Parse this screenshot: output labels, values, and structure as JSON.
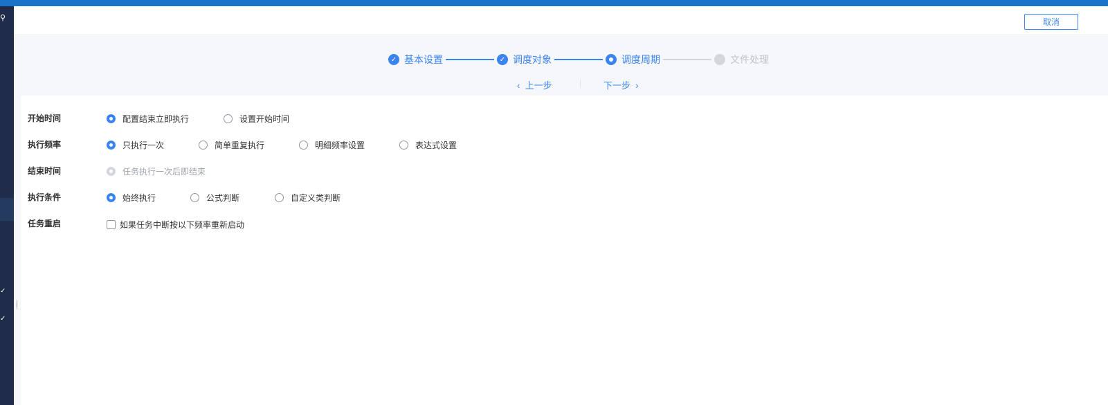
{
  "header": {
    "cancel_label": "取消"
  },
  "steps": [
    {
      "label": "基本设置",
      "status": "done"
    },
    {
      "label": "调度对象",
      "status": "done"
    },
    {
      "label": "调度周期",
      "status": "current"
    },
    {
      "label": "文件处理",
      "status": "pending"
    }
  ],
  "nav": {
    "prev_label": "上一步",
    "next_label": "下一步",
    "prev_icon": "‹",
    "next_icon": "›"
  },
  "form": {
    "start_time": {
      "label": "开始时间",
      "options": [
        "配置结束立即执行",
        "设置开始时间"
      ],
      "selected": 0
    },
    "frequency": {
      "label": "执行频率",
      "options": [
        "只执行一次",
        "简单重复执行",
        "明细频率设置",
        "表达式设置"
      ],
      "selected": 0
    },
    "end_time": {
      "label": "结束时间",
      "options": [
        "任务执行一次后即结束"
      ],
      "selected": 0,
      "disabled": true
    },
    "condition": {
      "label": "执行条件",
      "options": [
        "始终执行",
        "公式判断",
        "自定义类判断"
      ],
      "selected": 0
    },
    "restart": {
      "label": "任务重启",
      "checkbox_label": "如果任务中断按以下频率重新启动",
      "checked": false
    }
  },
  "colors": {
    "accent": "#3a84f0",
    "topbar": "#1a73c8",
    "sidebar": "#1f2d4a"
  }
}
